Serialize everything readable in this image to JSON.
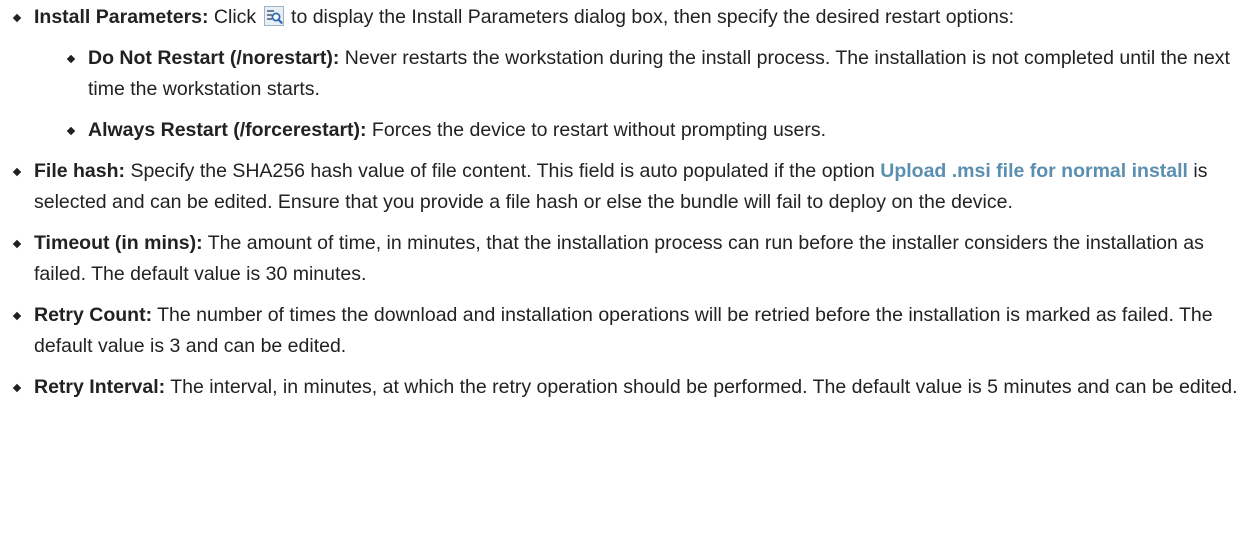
{
  "items": [
    {
      "term": "Install Parameters:",
      "text_before_icon": " Click ",
      "icon": "install-parameters-icon",
      "text_after_icon": " to display the Install Parameters dialog box, then specify the desired restart options:",
      "subitems": [
        {
          "term": "Do Not Restart (/norestart):",
          "text": " Never restarts the workstation during the install process. The installation is not completed until the next time the workstation starts."
        },
        {
          "term": "Always Restart (/forcerestart):",
          "text": " Forces the device to restart without prompting users."
        }
      ]
    },
    {
      "term": "File hash:",
      "text_before_link": " Specify the SHA256 hash value of file content. This field is auto populated if the option ",
      "link": "Upload .msi file for normal install",
      "text_after_link": " is selected and can be edited. Ensure that you provide a file hash or else the bundle will fail to deploy on the device."
    },
    {
      "term": "Timeout (in mins):",
      "text": " The amount of time, in minutes, that the installation process can run before the installer considers the installation as failed. The default value is 30 minutes."
    },
    {
      "term": "Retry Count:",
      "text": " The number of times the download and installation operations will be retried before the installation is marked as failed. The default value is 3 and can be edited."
    },
    {
      "term": "Retry Interval:",
      "text": " The interval, in minutes, at which the retry operation should be performed. The default value is 5 minutes and can be edited."
    }
  ],
  "colors": {
    "text": "#222222",
    "link": "#5b8fb0"
  }
}
